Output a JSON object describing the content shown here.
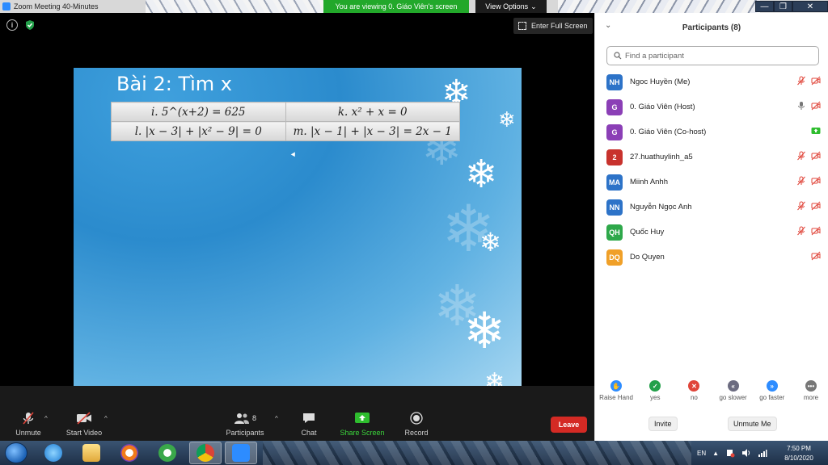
{
  "window": {
    "title": "Zoom Meeting 40-Minutes",
    "viewing_banner": "You are viewing 0. Giáo Viên's screen",
    "view_options": "View Options",
    "view_options_caret": "⌄",
    "controls": {
      "minimize": "—",
      "restore": "❐",
      "close": "✕"
    }
  },
  "video": {
    "fullscreen_label": "Enter Full Screen",
    "info_icon": "i"
  },
  "slide": {
    "title": "Bài 2: Tìm x",
    "equations": [
      [
        "i. 5^(x+2) = 625",
        "k. x² + x = 0"
      ],
      [
        "l. |x − 3| + |x² − 9| = 0",
        "m. |x − 1| + |x − 3| = 2x − 1"
      ]
    ],
    "flake_glyph": "❄"
  },
  "toolbar": {
    "unmute": "Unmute",
    "start_video": "Start Video",
    "participants": "Participants",
    "participants_count": "8",
    "chat": "Chat",
    "share_screen": "Share Screen",
    "record": "Record",
    "leave": "Leave",
    "caret": "^"
  },
  "panel": {
    "title": "Participants (8)",
    "collapse_glyph": "⌄",
    "search_placeholder": "Find a participant",
    "participants": [
      {
        "initials": "NH",
        "name": "Ngoc Huyền (Me)",
        "color": "#2d73c8",
        "mic": "muted",
        "video": "off"
      },
      {
        "initials": "G",
        "name": "0. Giáo Viên (Host)",
        "color": "#8b3fb6",
        "mic": "on",
        "video": "off"
      },
      {
        "initials": "G",
        "name": "0. Giáo Viên (Co-host)",
        "color": "#8b3fb6",
        "mic": "none",
        "video": "share"
      },
      {
        "initials": "2",
        "name": "27.huathuylinh_a5",
        "color": "#c8322d",
        "mic": "muted",
        "video": "off"
      },
      {
        "initials": "MA",
        "name": "Miinh Anhh",
        "color": "#2d73c8",
        "mic": "muted",
        "video": "off"
      },
      {
        "initials": "NN",
        "name": "Nguyễn Ngọc Anh",
        "color": "#2d73c8",
        "mic": "muted",
        "video": "off"
      },
      {
        "initials": "QH",
        "name": "Quốc Huy",
        "color": "#2ea84a",
        "mic": "muted",
        "video": "off"
      },
      {
        "initials": "DQ",
        "name": "Do Quyen",
        "color": "#f0a028",
        "mic": "none",
        "video": "off"
      }
    ],
    "reactions": [
      {
        "label": "Raise Hand",
        "icon": "✋",
        "color": "#2d8cff"
      },
      {
        "label": "yes",
        "icon": "✓",
        "color": "#23a04a"
      },
      {
        "label": "no",
        "icon": "✕",
        "color": "#e0453a"
      },
      {
        "label": "go slower",
        "icon": "«",
        "color": "#6b6b80"
      },
      {
        "label": "go faster",
        "icon": "»",
        "color": "#2d8cff"
      },
      {
        "label": "more",
        "icon": "•••",
        "color": "#777"
      }
    ],
    "invite": "Invite",
    "unmute_me": "Unmute Me"
  },
  "taskbar": {
    "language": "EN",
    "tray_arrow": "▲",
    "time": "7:50 PM",
    "date": "8/10/2020"
  },
  "colors": {
    "zoom_blue": "#2d8cff",
    "leave_red": "#d42a24",
    "share_green": "#3bd43b",
    "banner_green": "#22a82a"
  }
}
